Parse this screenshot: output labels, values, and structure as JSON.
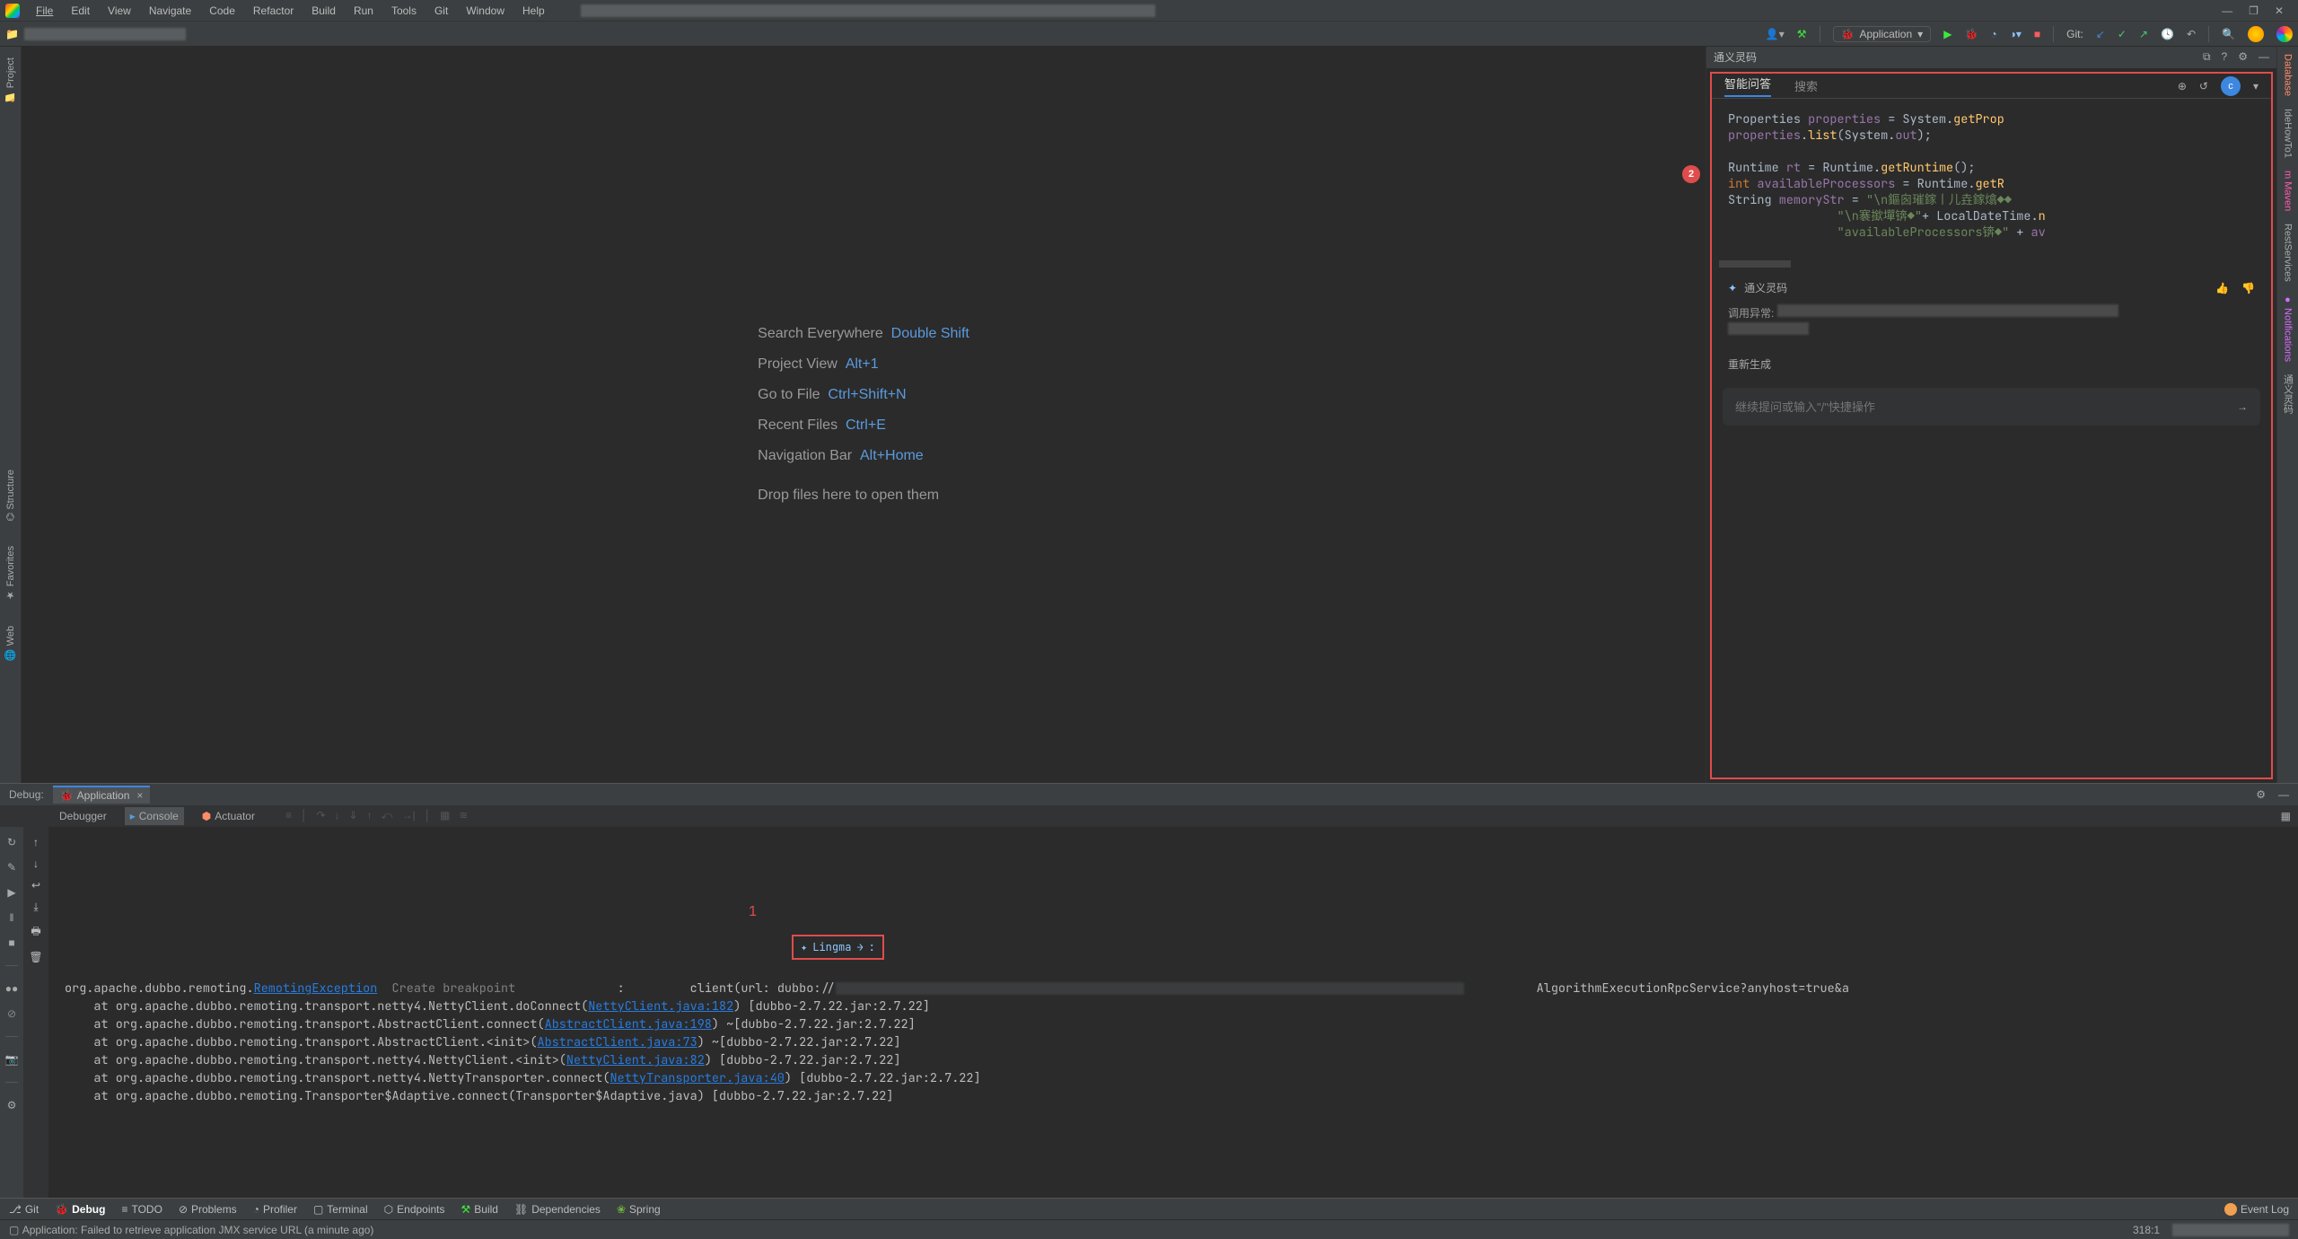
{
  "menubar": {
    "items": [
      "File",
      "Edit",
      "View",
      "Navigate",
      "Code",
      "Refactor",
      "Build",
      "Run",
      "Tools",
      "Git",
      "Window",
      "Help"
    ]
  },
  "nav": {
    "run_config_label": "Application",
    "git_label": "Git:"
  },
  "leftrail": {
    "project": "Project",
    "structure": "Structure",
    "favorites": "Favorites",
    "web": "Web"
  },
  "welcome": {
    "rows": [
      {
        "label": "Search Everywhere",
        "shortcut": "Double Shift"
      },
      {
        "label": "Project View",
        "shortcut": "Alt+1"
      },
      {
        "label": "Go to File",
        "shortcut": "Ctrl+Shift+N"
      },
      {
        "label": "Recent Files",
        "shortcut": "Ctrl+E"
      },
      {
        "label": "Navigation Bar",
        "shortcut": "Alt+Home"
      }
    ],
    "drop": "Drop files here to open them"
  },
  "rightpanel": {
    "title": "通义灵码",
    "badge": "2",
    "tabs": {
      "qa": "智能问答",
      "search": "搜索"
    },
    "avatar": "c",
    "code_lines": [
      "Properties properties = System.getProp",
      "properties.list(System.out);",
      "",
      "Runtime rt = Runtime.getRuntime();",
      "int availableProcessors = Runtime.getR",
      "String memoryStr = \"\\n鏂囪璀鎵丨儿垚鎵熻◆◆",
      "               \"\\n褰撳墠锛◆\"+ LocalDateTime.n",
      "               \"availableProcessors锛◆\" + av"
    ],
    "meta_name": "通义灵码",
    "exc_label": "调用异常:",
    "regen": "重新生成",
    "input_placeholder": "继续提问或输入\"/\"快捷操作"
  },
  "debug": {
    "label": "Debug:",
    "tab_name": "Application",
    "tabs2": [
      "Debugger",
      "Console",
      "Actuator"
    ],
    "num_marker": "1",
    "lingma_label": "Lingma",
    "lines": {
      "l0_pre": "org.apache.dubbo.remoting.",
      "l0_exc": "RemotingException",
      "l0_action": "Create breakpoint",
      "l0_post": ":         client(url: dubbo://",
      "l0_tail": "AlgorithmExecutionRpcService?anyhost=true&a",
      "l1": "    at org.apache.dubbo.remoting.transport.netty4.NettyClient.doConnect(",
      "l1_lnk": "NettyClient.java:182",
      "l1_post": ") [dubbo-2.7.22.jar:2.7.22]",
      "l2": "    at org.apache.dubbo.remoting.transport.AbstractClient.connect(",
      "l2_lnk": "AbstractClient.java:198",
      "l2_post": ") ~[dubbo-2.7.22.jar:2.7.22]",
      "l3": "    at org.apache.dubbo.remoting.transport.AbstractClient.<init>(",
      "l3_lnk": "AbstractClient.java:73",
      "l3_post": ") ~[dubbo-2.7.22.jar:2.7.22]",
      "l4": "    at org.apache.dubbo.remoting.transport.netty4.NettyClient.<init>(",
      "l4_lnk": "NettyClient.java:82",
      "l4_post": ") [dubbo-2.7.22.jar:2.7.22]",
      "l5": "    at org.apache.dubbo.remoting.transport.netty4.NettyTransporter.connect(",
      "l5_lnk": "NettyTransporter.java:40",
      "l5_post": ") [dubbo-2.7.22.jar:2.7.22]",
      "l6": "    at org.apache.dubbo.remoting.Transporter$Adaptive.connect(Transporter$Adaptive.java) [dubbo-2.7.22.jar:2.7.22]"
    }
  },
  "bottombar": {
    "items": [
      {
        "icon": "git-icon",
        "label": "Git"
      },
      {
        "icon": "bug-icon",
        "label": "Debug",
        "active": true
      },
      {
        "icon": "todo-icon",
        "label": "TODO"
      },
      {
        "icon": "problems-icon",
        "label": "Problems"
      },
      {
        "icon": "profiler-icon",
        "label": "Profiler"
      },
      {
        "icon": "terminal-icon",
        "label": "Terminal"
      },
      {
        "icon": "endpoints-icon",
        "label": "Endpoints"
      },
      {
        "icon": "build-icon",
        "label": "Build"
      },
      {
        "icon": "dependencies-icon",
        "label": "Dependencies"
      },
      {
        "icon": "spring-icon",
        "label": "Spring"
      }
    ],
    "event_log": "Event Log"
  },
  "statusbar": {
    "msg": "Application: Failed to retrieve application JMX service URL (a minute ago)",
    "pos": "318:1"
  }
}
